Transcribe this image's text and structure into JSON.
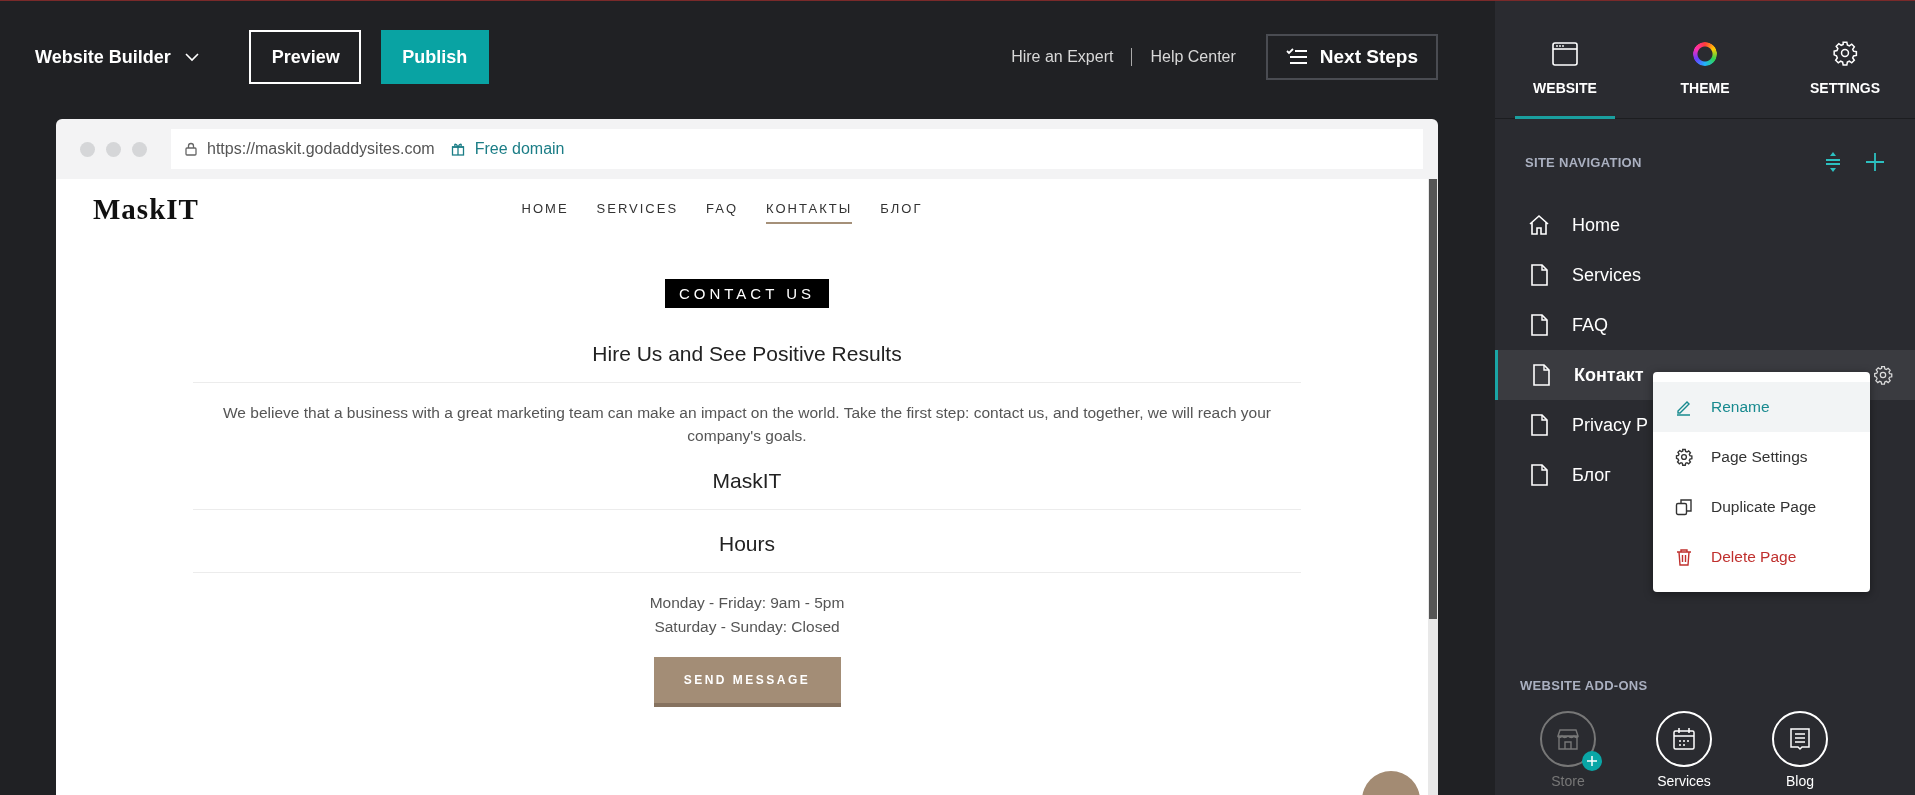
{
  "header": {
    "app_menu": "Website Builder",
    "buttons": [
      {
        "label": "Preview",
        "kind": "outline"
      },
      {
        "label": "Publish",
        "kind": "primary"
      }
    ],
    "links": [
      "Hire an Expert",
      "Help Center"
    ],
    "next_steps": "Next Steps"
  },
  "browser": {
    "url": "https://maskit.godaddysites.com",
    "domain_link": "Free domain"
  },
  "site": {
    "logo": "MaskIT",
    "nav": [
      {
        "label": "HOME",
        "selected": false
      },
      {
        "label": "SERVICES",
        "selected": false
      },
      {
        "label": "FAQ",
        "selected": false
      },
      {
        "label": "КОНТАКТЫ",
        "selected": true
      },
      {
        "label": "БЛОГ",
        "selected": false
      }
    ],
    "badge": "CONTACT US",
    "heading": "Hire Us and See Positive Results",
    "intro": "We believe that a business with a great marketing team can make an impact on the world. Take the first step: contact us, and together, we will reach your company's goals.",
    "business_name": "MaskIT",
    "hours_title": "Hours",
    "hours": [
      "Monday - Friday: 9am - 5pm",
      "Saturday - Sunday: Closed"
    ],
    "cta": "SEND MESSAGE"
  },
  "panel": {
    "tabs": [
      {
        "label": "WEBSITE",
        "kind": "website",
        "selected": true
      },
      {
        "label": "THEME",
        "kind": "theme",
        "selected": false
      },
      {
        "label": "SETTINGS",
        "kind": "settings",
        "selected": false
      }
    ],
    "nav_title": "SITE NAVIGATION",
    "pages": [
      {
        "label": "Home",
        "kind": "home",
        "selected": false
      },
      {
        "label": "Services",
        "kind": "page",
        "selected": false
      },
      {
        "label": "FAQ",
        "kind": "page",
        "selected": false
      },
      {
        "label": "Контакт",
        "kind": "page",
        "selected": true
      },
      {
        "label": "Privacy P",
        "kind": "page",
        "selected": false
      },
      {
        "label": "Блог",
        "kind": "page",
        "selected": false
      }
    ],
    "menu": [
      {
        "label": "Rename",
        "kind": "rename",
        "selected": true
      },
      {
        "label": "Page Settings",
        "kind": "settings",
        "selected": false
      },
      {
        "label": "Duplicate Page",
        "kind": "duplicate",
        "selected": false
      },
      {
        "label": "Delete Page",
        "kind": "delete",
        "selected": false
      }
    ],
    "addons_title": "WEBSITE ADD-ONS",
    "addons": [
      {
        "label": "Store",
        "kind": "store",
        "disabled": true
      },
      {
        "label": "Services",
        "kind": "calendar",
        "disabled": false
      },
      {
        "label": "Blog",
        "kind": "blog",
        "disabled": false
      }
    ]
  }
}
